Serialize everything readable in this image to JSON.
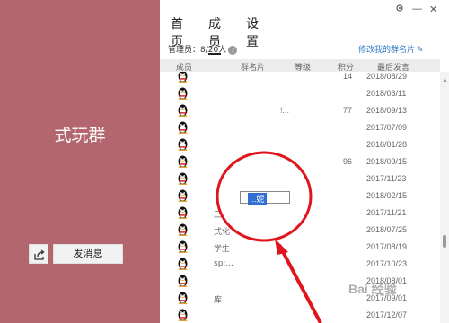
{
  "left_panel": {
    "group_name": "式玩群",
    "send_message_label": "发消息",
    "share_icon": "share-icon"
  },
  "window": {
    "settings_icon": "gear-icon",
    "minimize": "—",
    "close": "✕"
  },
  "tabs": [
    {
      "label": "首页",
      "active": false
    },
    {
      "label": "成员",
      "active": true
    },
    {
      "label": "设置",
      "active": false
    }
  ],
  "admin_text": "管理员：8/20人",
  "edit_card_link": "修改我的群名片",
  "columns": [
    "成员",
    "群名片",
    "等级",
    "积分",
    "最后发言"
  ],
  "rows": [
    {
      "name": "",
      "card": "",
      "score": "14",
      "date": "2018/08/29"
    },
    {
      "name": "",
      "card": "",
      "score": "",
      "date": "2018/03/11"
    },
    {
      "name": "",
      "card": "!...",
      "score": "77",
      "date": "2018/09/13"
    },
    {
      "name": "",
      "card": "",
      "score": "",
      "date": "2017/07/09"
    },
    {
      "name": "",
      "card": "",
      "score": "",
      "date": "2018/01/28"
    },
    {
      "name": "",
      "card": "",
      "score": "96",
      "date": "2018/09/15"
    },
    {
      "name": "",
      "card": "",
      "score": "",
      "date": "2017/11/23"
    },
    {
      "name": "",
      "card": "",
      "score": "",
      "date": "2018/02/15"
    },
    {
      "name": "三",
      "card": "",
      "score": "",
      "date": "2017/11/21"
    },
    {
      "name": "式化",
      "card": "",
      "score": "",
      "date": "2018/07/25"
    },
    {
      "name": "学生",
      "card": "",
      "score": "",
      "date": "2017/08/19"
    },
    {
      "name": "sp;...",
      "card": "",
      "score": "",
      "date": "2017/10/23"
    },
    {
      "name": "",
      "card": "",
      "score": "",
      "date": "2018/08/01"
    },
    {
      "name": "库",
      "card": "",
      "score": "",
      "date": "2017/09/01"
    },
    {
      "name": "",
      "card": "",
      "score": "",
      "date": "2017/12/07"
    }
  ],
  "edit_box_text": "...妮",
  "watermark": "Bai 经验",
  "colors": {
    "left_bg": "#b3666e",
    "link": "#2a77c9",
    "annotation": "#e0141c",
    "selection": "#2e6fd0"
  }
}
